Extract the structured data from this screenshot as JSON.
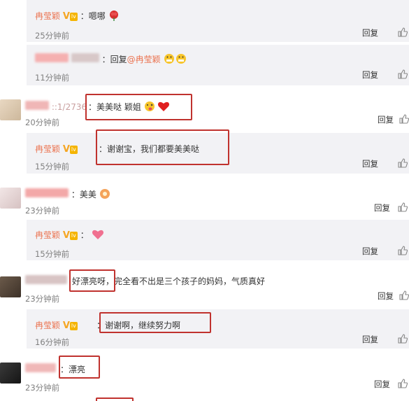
{
  "comments": [
    {
      "author": "冉莹颖",
      "text": "：嗯哪",
      "time": "25分钟前",
      "reply": "回复"
    },
    {
      "author": "",
      "reply_prefix": "：回复",
      "mention": "@冉莹颖",
      "time": "11分钟前",
      "reply": "回复"
    },
    {
      "author": "::1/2736",
      "text": "：美美哒 颖姐",
      "time": "20分钟前",
      "reply": "回复"
    },
    {
      "author": "冉莹颖",
      "text": "：谢谢宝，我们都要美美哒",
      "time": "15分钟前",
      "reply": "回复"
    },
    {
      "author": "",
      "text": "：美美",
      "time": "23分钟前",
      "reply": "回复"
    },
    {
      "author": "冉莹颖",
      "text": "：",
      "time": "15分钟前",
      "reply": "回复"
    },
    {
      "author": "",
      "text_a": "好漂亮呀，",
      "text_b": "完全看不出是三个孩子的妈妈，气质真好",
      "time": "23分钟前",
      "reply": "回复"
    },
    {
      "author": "冉莹颖",
      "text": "：谢谢啊，继续努力啊",
      "time": "16分钟前",
      "reply": "回复"
    },
    {
      "author": "",
      "text": "：漂亮",
      "time": "23分钟前",
      "reply": "回复"
    }
  ],
  "badge": {
    "v": "V",
    "level": "lv"
  },
  "colors": {
    "name": "#eb7350",
    "reply_bg": "#f2f2f5",
    "highlight_box": "#c0322e"
  },
  "icons": [
    "thumbs-up-icon",
    "rose-emoji",
    "heart-emoji",
    "tongue-emoji",
    "grin-emoji",
    "flower-emoji"
  ]
}
